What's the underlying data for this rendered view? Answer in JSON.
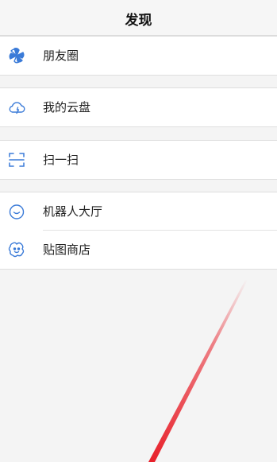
{
  "header": {
    "title": "发现"
  },
  "groups": [
    {
      "items": [
        {
          "label": "朋友圈",
          "icon": "moments-icon"
        }
      ]
    },
    {
      "items": [
        {
          "label": "我的云盘",
          "icon": "cloud-icon"
        }
      ]
    },
    {
      "items": [
        {
          "label": "扫一扫",
          "icon": "scan-icon"
        }
      ]
    },
    {
      "items": [
        {
          "label": "机器人大厅",
          "icon": "robot-icon"
        },
        {
          "label": "贴图商店",
          "icon": "sticker-icon"
        }
      ]
    }
  ],
  "colors": {
    "accent": "#3b7bd8",
    "background": "#f4f4f4",
    "laser": "#e8202a"
  }
}
